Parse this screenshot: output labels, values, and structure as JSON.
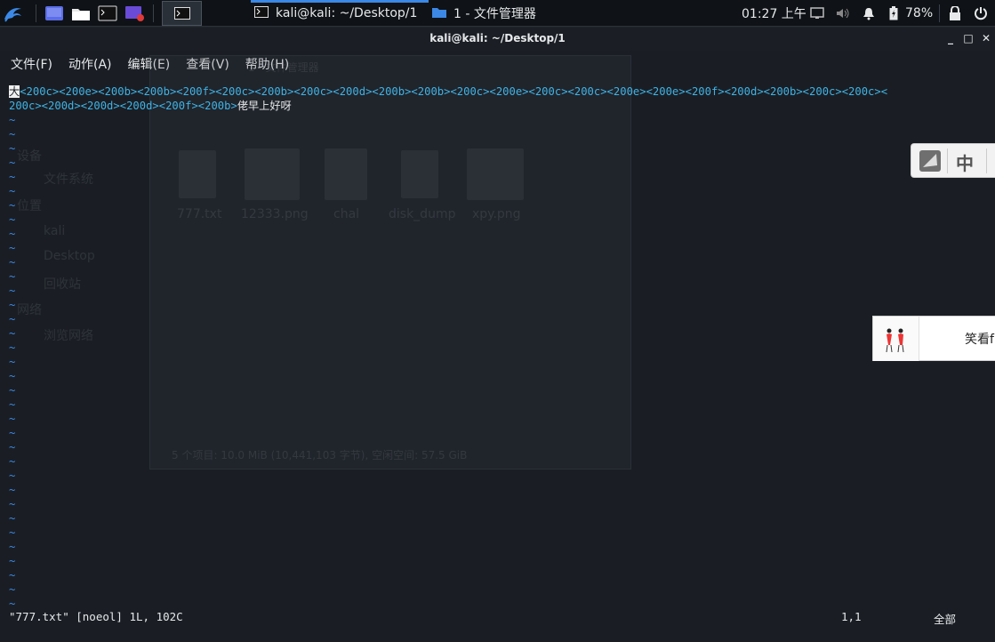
{
  "panel": {
    "tasks": [
      {
        "label": "kali@kali: ~/Desktop/1",
        "icon": "terminal-icon"
      },
      {
        "label": "1 - 文件管理器",
        "icon": "folder-icon"
      }
    ],
    "clock": "01:27 上午",
    "battery": "78%"
  },
  "window": {
    "title": "kali@kali: ~/Desktop/1",
    "menu": [
      "文件(F)",
      "动作(A)",
      "编辑(E)",
      "查看(V)",
      "帮助(H)"
    ]
  },
  "editor": {
    "cursor_char": "大",
    "line1_special": "<200c><200e><200b><200b><200f><200c><200b><200c><200d><200b><200b><200c><200e><200c><200c><200e><200e><200f><200d><200b><200c><200c><",
    "line2_special": "200c><200d><200d><200d><200f><200b>",
    "line2_text": "佬早上好呀",
    "tilde": "~",
    "status_file": "\"777.txt\" [noeol] 1L, 102C",
    "status_pos": "1,1",
    "status_all": "全部"
  },
  "ghost": {
    "title": "1 - 文件管理器",
    "sidebar": [
      "设备",
      "文件系统",
      "位置",
      "kali",
      "Desktop",
      "回收站",
      "网络",
      "浏览网络"
    ],
    "files": [
      "777.txt",
      "12333.png",
      "chal",
      "disk_dump",
      "xpy.png"
    ],
    "status": "5 个项目: 10.0 MiB (10,441,103 字节), 空闲空间: 57.5 GiB"
  },
  "ime": {
    "label": "中"
  },
  "notify": {
    "text": "笑看f"
  },
  "colors": {
    "accent": "#3b88e6",
    "special": "#3fb3e6",
    "bg": "#1a1e24"
  }
}
